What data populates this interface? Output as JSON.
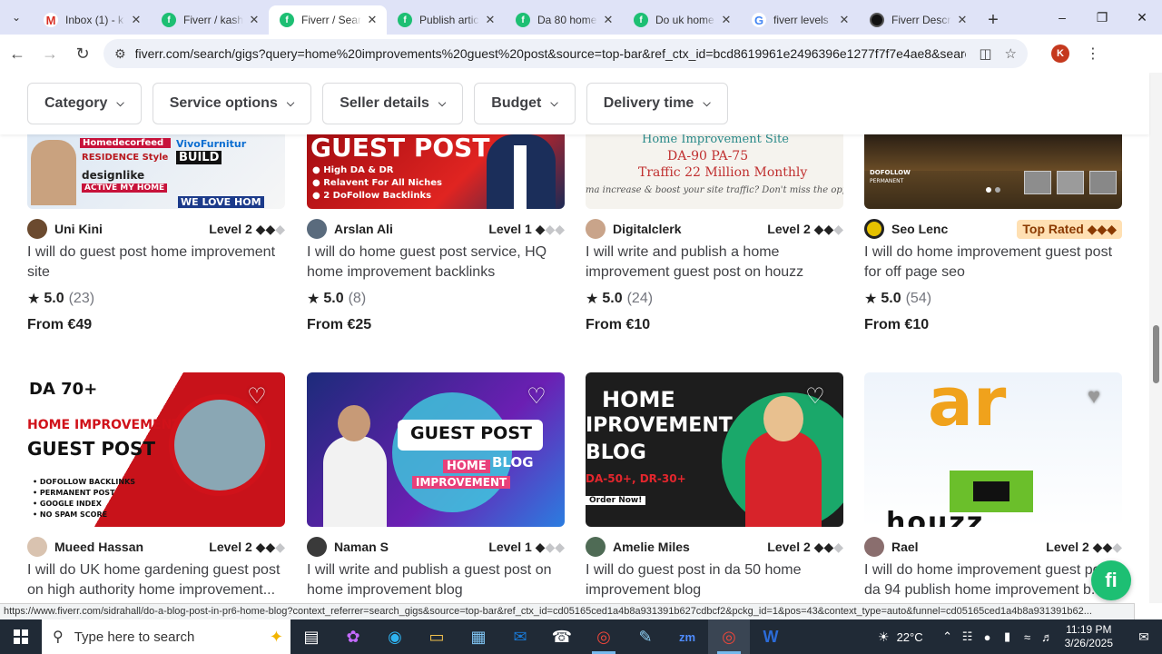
{
  "browser": {
    "tabs": [
      {
        "title": "Inbox (1) - k",
        "icon": "gmail-icon",
        "active": false
      },
      {
        "title": "Fiverr / kash",
        "icon": "fiverr-icon",
        "active": false
      },
      {
        "title": "Fiverr / Sear",
        "icon": "fiverr-icon",
        "active": true
      },
      {
        "title": "Publish artic",
        "icon": "fiverr-icon",
        "active": false
      },
      {
        "title": "Da 80 home",
        "icon": "fiverr-icon",
        "active": false
      },
      {
        "title": "Do uk home",
        "icon": "fiverr-icon",
        "active": false
      },
      {
        "title": "fiverr levels",
        "icon": "google-icon",
        "active": false
      },
      {
        "title": "Fiverr Descri",
        "icon": "dark-icon",
        "active": false
      }
    ],
    "url": "fiverr.com/search/gigs?query=home%20improvements%20guest%20post&source=top-bar&ref_ctx_id=bcd8619961e2496396e1277f7f7e4ae8&search_in=everywhere&...",
    "profile_initial": "K"
  },
  "filters": [
    {
      "label": "Category"
    },
    {
      "label": "Service options"
    },
    {
      "label": "Seller details"
    },
    {
      "label": "Budget"
    },
    {
      "label": "Delivery time"
    }
  ],
  "gigs_row1": [
    {
      "seller": "Uni Kini",
      "level": "Level 2",
      "level_stars": 2,
      "title": "I will do guest post home improvement site",
      "rating": "5.0",
      "reviews": "(23)",
      "price": "From €49",
      "avatar_color": "#6b4a2f"
    },
    {
      "seller": "Arslan Ali",
      "level": "Level 1",
      "level_stars": 1,
      "title": "I will do home guest post service, HQ home improvement backlinks",
      "rating": "5.0",
      "reviews": "(8)",
      "price": "From €25",
      "avatar_color": "#5a6b7d"
    },
    {
      "seller": "Digitalclerk",
      "level": "Level 2",
      "level_stars": 2,
      "title": "I will write and publish a home improvement guest post on houzz",
      "rating": "5.0",
      "reviews": "(24)",
      "price": "From €10",
      "avatar_color": "#c9a48a"
    },
    {
      "seller": "Seo Lenc",
      "level": "Top Rated",
      "level_stars": 3,
      "title": "I will do home improvement guest post for off page seo",
      "rating": "5.0",
      "reviews": "(54)",
      "price": "From €10",
      "avatar_color": "#e5c100"
    }
  ],
  "gigs_row1_art": {
    "g1": [
      "Homedecorfeed",
      "VivoFurnitur",
      "RESIDENCE Style",
      "BUILD",
      "designlike",
      "ACTIVE MY HOME",
      "WE LOVE HOM"
    ],
    "g2": [
      "GUEST POST",
      "High DA & DR",
      "Relavent For All Niches",
      "2 DoFollow Backlinks"
    ],
    "g3": [
      "Home Improvement Site",
      "DA-90  PA-75",
      "Traffic 22 Million Monthly",
      "ma increase & boost your site traffic? Don't miss the opportu"
    ],
    "g4": [
      "DOFOLLOW",
      "PERMANENT"
    ]
  },
  "gigs_row2": [
    {
      "seller": "Mueed Hassan",
      "level": "Level 2",
      "level_stars": 2,
      "title": "I will do UK home gardening guest post on high authority home improvement...",
      "avatar_color": "#d9c3b0"
    },
    {
      "seller": "Naman S",
      "level": "Level 1",
      "level_stars": 1,
      "title": "I will write and publish a guest post on home improvement blog",
      "avatar_color": "#3a3a3a"
    },
    {
      "seller": "Amelie Miles",
      "level": "Level 2",
      "level_stars": 2,
      "title": "I will do guest post in da 50 home improvement blog",
      "avatar_color": "#4f6b55"
    },
    {
      "seller": "Rael",
      "level": "Level 2",
      "level_stars": 2,
      "title": "I will do home improvement guest post da 94 publish home improvement b...",
      "avatar_color": "#8a6e6e"
    }
  ],
  "gigs_row2_art": {
    "g5": [
      "DA 70+",
      "HOME IMPROVEMENT",
      "GUEST POST",
      "DOFOLLOW BACKLINKS",
      "PERMANENT POST",
      "GOOGLE INDEX",
      "NO SPAM SCORE"
    ],
    "g6": [
      "GUEST POST",
      "HOME",
      "BLOG",
      "IMPROVEMENT"
    ],
    "g7": [
      "HOME",
      "IPROVEMENT",
      "BLOG",
      "DA-50+, DR-30+",
      "Order Now!"
    ],
    "g8": [
      "ar",
      "houzz"
    ]
  },
  "status_url": "https://www.fiverr.com/sidrahall/do-a-blog-post-in-pr6-home-blog?context_referrer=search_gigs&source=top-bar&ref_ctx_id=cd05165ced1a4b8a931391b627cdbcf2&pckg_id=1&pos=43&context_type=auto&funnel=cd05165ced1a4b8a931391b62...",
  "chat_button": "fi",
  "taskbar": {
    "search_placeholder": "Type here to search",
    "temperature": "22°C",
    "time": "11:19 PM",
    "date": "3/26/2025"
  },
  "colors": {
    "fiverr_green": "#1dbf73",
    "taskbar": "#202a36",
    "tab_strip": "#dfe3f7"
  }
}
